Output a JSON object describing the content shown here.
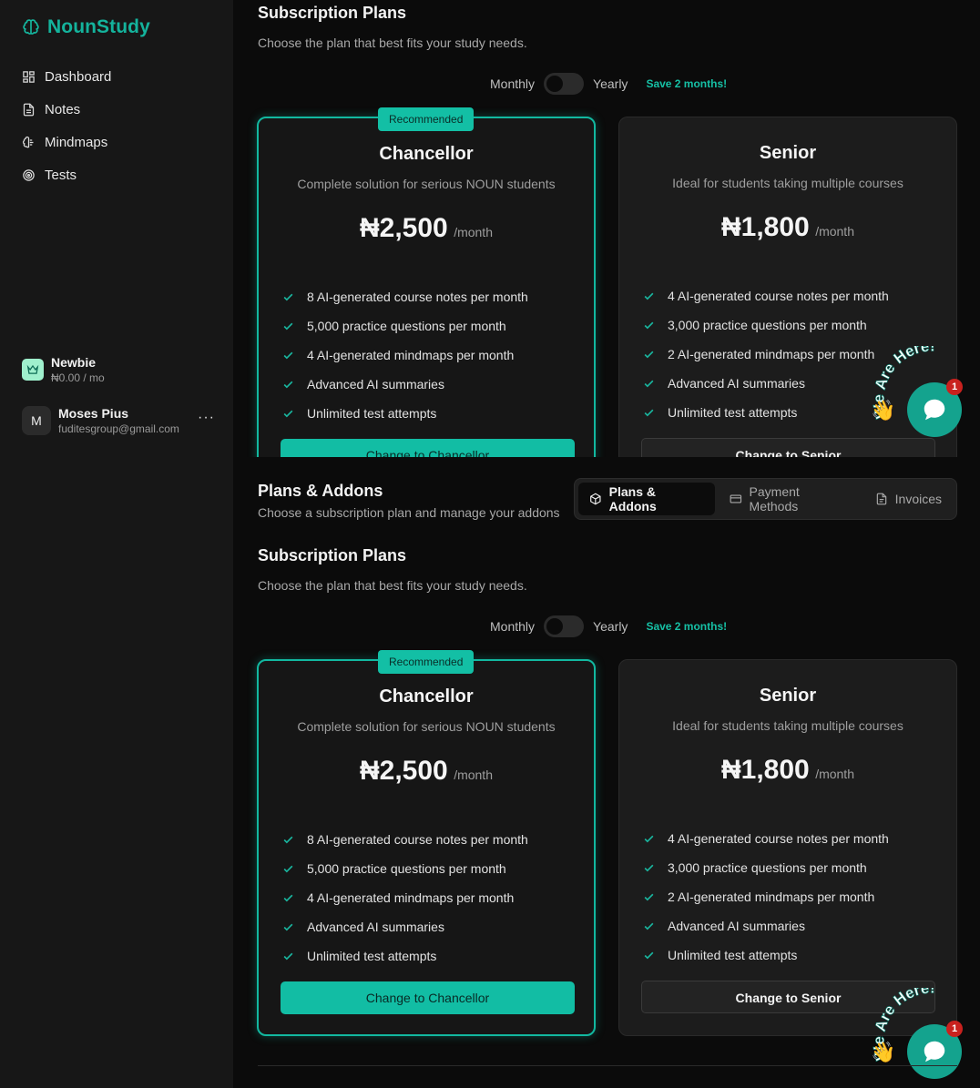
{
  "brand": {
    "name": "NounStudy"
  },
  "nav": [
    {
      "label": "Dashboard",
      "icon": "dashboard-icon"
    },
    {
      "label": "Notes",
      "icon": "document-icon"
    },
    {
      "label": "Mindmaps",
      "icon": "brain-icon"
    },
    {
      "label": "Tests",
      "icon": "target-icon"
    }
  ],
  "current_plan": {
    "name": "Newbie",
    "price": "₦0.00 / mo",
    "icon": "crown-icon"
  },
  "user": {
    "initial": "M",
    "name": "Moses Pius",
    "email": "fuditesgroup@gmail.com",
    "more": "···"
  },
  "header": {
    "title": "Plans & Addons",
    "subtitle": "Choose a subscription plan and manage your addons"
  },
  "tabs": [
    {
      "label": "Plans & Addons",
      "icon": "package-icon",
      "active": true
    },
    {
      "label": "Payment Methods",
      "icon": "credit-card-icon",
      "active": false
    },
    {
      "label": "Invoices",
      "icon": "invoice-icon",
      "active": false
    }
  ],
  "subscription": {
    "title": "Subscription Plans",
    "subtitle": "Choose the plan that best fits your study needs.",
    "billing": {
      "monthly": "Monthly",
      "yearly": "Yearly",
      "save": "Save 2 months!"
    }
  },
  "plans": [
    {
      "badge": "Recommended",
      "name": "Chancellor",
      "description": "Complete solution for serious NOUN students",
      "price": "₦2,500",
      "period": "/month",
      "features": [
        "8 AI-generated course notes per month",
        "5,000 practice questions per month",
        "4 AI-generated mindmaps per month",
        "Advanced AI summaries",
        "Unlimited test attempts"
      ],
      "button": "Change to Chancellor"
    },
    {
      "name": "Senior",
      "description": "Ideal for students taking multiple courses",
      "price": "₦1,800",
      "period": "/month",
      "features": [
        "4 AI-generated course notes per month",
        "3,000 practice questions per month",
        "2 AI-generated mindmaps per month",
        "Advanced AI summaries",
        "Unlimited test attempts"
      ],
      "button": "Change to Senior"
    }
  ],
  "chat_widget": {
    "text": "We Are Here!",
    "count": "1",
    "accent": "#14a38e"
  }
}
